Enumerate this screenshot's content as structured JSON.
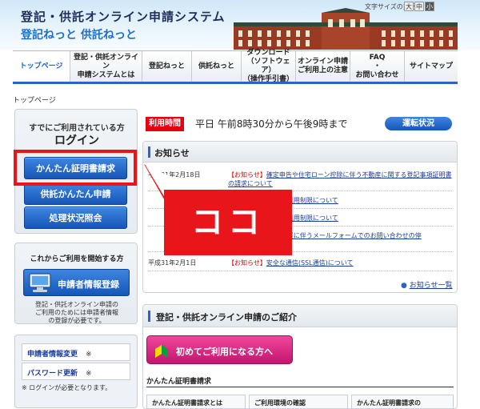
{
  "header": {
    "title": "登記・供託オンライン申請システム",
    "subtitle": "登記ねっと 供託ねっと",
    "font_size_label": "文字サイズの変更",
    "font_sizes": [
      "大",
      "中",
      "小"
    ]
  },
  "nav": {
    "items": [
      {
        "label": "トップページ",
        "active": true
      },
      {
        "label": "登記・供託オンライン\n申請システムとは"
      },
      {
        "label": "登記ねっと"
      },
      {
        "label": "供託ねっと"
      },
      {
        "label": "ダウンロード\n（ソフトウェア）\n（操作手引書）"
      },
      {
        "label": "オンライン申請\nご利用上の注意"
      },
      {
        "label": "FAQ\n・\nお問い合わせ"
      },
      {
        "label": "サイトマップ"
      }
    ]
  },
  "breadcrumb": "トップページ",
  "side_login": {
    "note": "すでにご利用されている方",
    "title": "ログイン",
    "buttons": [
      "かんたん証明書請求",
      "供託かんたん申請",
      "処理状況照会"
    ]
  },
  "side_register": {
    "title": "これからご利用を開始する方",
    "button": "申請者情報登録",
    "desc": "登記・供託オンライン申請の\nご利用のためには申請者情報\nの登録が必要です。"
  },
  "side_account": {
    "links": [
      {
        "label": "申請者情報変更",
        "mark": "※"
      },
      {
        "label": "パスワード更新",
        "mark": "※"
      }
    ],
    "foot": "※ ログインが必要となります。"
  },
  "hours": {
    "label": "利用時間",
    "text": "平日 午前8時30分から午後9時まで",
    "status_button": "運転状況"
  },
  "news": {
    "title": "お知らせ",
    "items": [
      {
        "date": "平成31年2月18日",
        "tag": "【お知らせ】",
        "text": "確定申告や住宅ローン控除に伴う不動産に関する登記事項証明書の請求について"
      },
      {
        "date": "",
        "tag": "",
        "text": "の一時利用制限について"
      },
      {
        "date": "",
        "tag": "",
        "text": "の一時利用制限について"
      },
      {
        "date": "",
        "tag": "",
        "text": "ンス作業に伴うメールフォームでのお問い合わせの停"
      },
      {
        "date": "平成31年2月1日",
        "tag": "【お知らせ】",
        "text": "安全な通信(SSL通信)について"
      }
    ],
    "more": "お知らせ一覧"
  },
  "callout": {
    "text": "ココ",
    "color": "#e8151b"
  },
  "intro": {
    "title": "登記・供託オンライン申請のご紹介",
    "first_button": "初めてご利用になる方へ",
    "cert_title": "かんたん証明書請求",
    "cols": [
      "かんたん証明書請求とは",
      "ご利用環境の確認",
      "かんたん証明書請求の"
    ]
  },
  "colors": {
    "accent": "#2a64c8",
    "button": "#1656b8",
    "alert": "#e60012",
    "pink": "#d82b83"
  }
}
